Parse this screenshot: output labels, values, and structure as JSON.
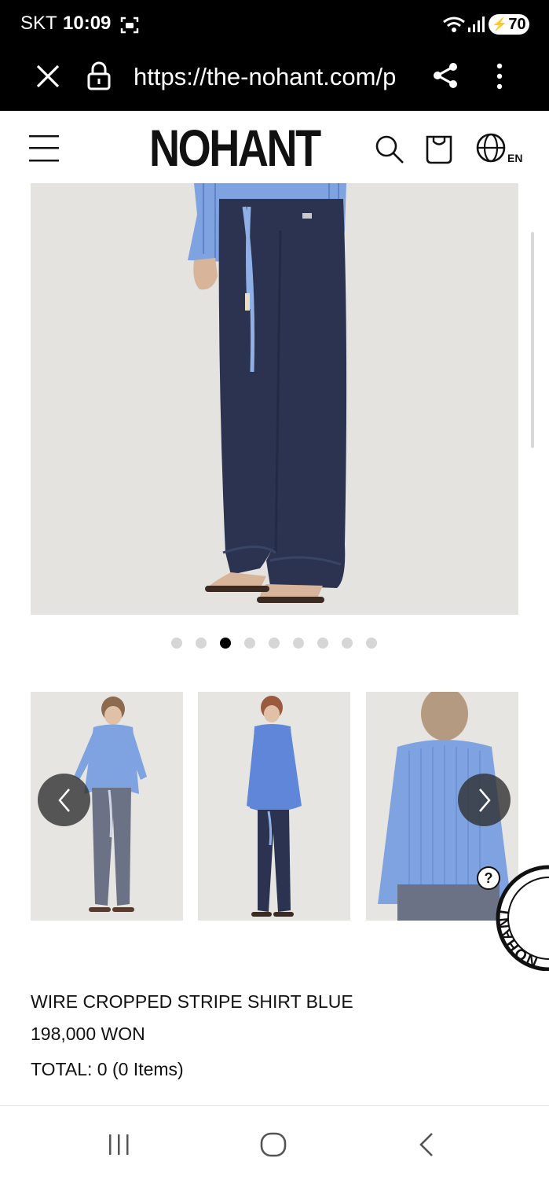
{
  "status_bar": {
    "carrier": "SKT",
    "time": "10:09",
    "battery": "70"
  },
  "browser": {
    "url": "https://the-nohant.com/p",
    "icons": [
      "close-icon",
      "lock-icon",
      "share-icon",
      "more-vert-icon"
    ]
  },
  "header": {
    "logo": "NOHANT",
    "language": "EN",
    "icons": [
      "menu-icon",
      "search-icon",
      "cart-icon",
      "globe-icon"
    ]
  },
  "gallery": {
    "total_images": 9,
    "active_index": 2
  },
  "product": {
    "name": "WIRE CROPPED STRIPE SHIRT BLUE",
    "price": "198,000 WON",
    "total": "TOTAL: 0 (0 Items)"
  },
  "badge": {
    "text": "NOHANT",
    "icon": "help-icon"
  },
  "colors": {
    "shirt_blue": "#7fa3e0",
    "pants_navy": "#2b3350",
    "pants_grey": "#6c7286",
    "background": "#e4e3df"
  },
  "system_nav": {
    "icons": [
      "recent-apps-icon",
      "home-icon",
      "back-icon"
    ]
  }
}
